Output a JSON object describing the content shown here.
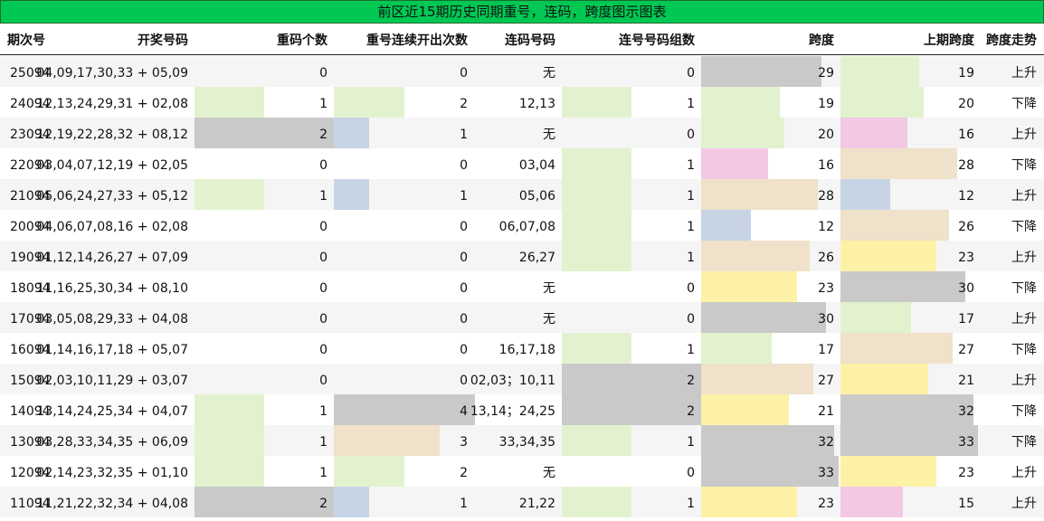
{
  "title": "前区近15期历史同期重号，连码，跨度图示图表",
  "headers": {
    "period": "期次号",
    "numbers": "开奖号码",
    "repeat_count": "重码个数",
    "repeat_streak": "重号连续开出次数",
    "consec_numbers": "连码号码",
    "consec_groups": "连号号码组数",
    "span": "跨度",
    "prev_span": "上期跨度",
    "span_trend": "跨度走势"
  },
  "colors": {
    "title_bg": "#00c853",
    "green": "#e2f2cf",
    "gray": "#c9c9c9",
    "blue": "#c7d4e6",
    "pink": "#f2c8e4",
    "tan": "#efe1ca",
    "yellow": "#fdf1a6"
  },
  "rows": [
    {
      "period": "25094",
      "numbers": "04,09,17,30,33 + 05,09",
      "repeat_count": "0",
      "repeat_streak": "0",
      "consec": "无",
      "groups": "0",
      "span": "29",
      "prev_span": "19",
      "trend": "上升"
    },
    {
      "period": "24094",
      "numbers": "12,13,24,29,31 + 02,08",
      "repeat_count": "1",
      "repeat_streak": "2",
      "consec": "12,13",
      "groups": "1",
      "span": "19",
      "prev_span": "20",
      "trend": "下降"
    },
    {
      "period": "23094",
      "numbers": "12,19,22,28,32 + 08,12",
      "repeat_count": "2",
      "repeat_streak": "1",
      "consec": "无",
      "groups": "0",
      "span": "20",
      "prev_span": "16",
      "trend": "上升"
    },
    {
      "period": "22094",
      "numbers": "03,04,07,12,19 + 02,05",
      "repeat_count": "0",
      "repeat_streak": "0",
      "consec": "03,04",
      "groups": "1",
      "span": "16",
      "prev_span": "28",
      "trend": "下降"
    },
    {
      "period": "21094",
      "numbers": "05,06,24,27,33 + 05,12",
      "repeat_count": "1",
      "repeat_streak": "1",
      "consec": "05,06",
      "groups": "1",
      "span": "28",
      "prev_span": "12",
      "trend": "上升"
    },
    {
      "period": "20094",
      "numbers": "04,06,07,08,16 + 02,08",
      "repeat_count": "0",
      "repeat_streak": "0",
      "consec": "06,07,08",
      "groups": "1",
      "span": "12",
      "prev_span": "26",
      "trend": "下降"
    },
    {
      "period": "19094",
      "numbers": "01,12,14,26,27 + 07,09",
      "repeat_count": "0",
      "repeat_streak": "0",
      "consec": "26,27",
      "groups": "1",
      "span": "26",
      "prev_span": "23",
      "trend": "上升"
    },
    {
      "period": "18094",
      "numbers": "11,16,25,30,34 + 08,10",
      "repeat_count": "0",
      "repeat_streak": "0",
      "consec": "无",
      "groups": "0",
      "span": "23",
      "prev_span": "30",
      "trend": "下降"
    },
    {
      "period": "17094",
      "numbers": "03,05,08,29,33 + 04,08",
      "repeat_count": "0",
      "repeat_streak": "0",
      "consec": "无",
      "groups": "0",
      "span": "30",
      "prev_span": "17",
      "trend": "上升"
    },
    {
      "period": "16094",
      "numbers": "01,14,16,17,18 + 05,07",
      "repeat_count": "0",
      "repeat_streak": "0",
      "consec": "16,17,18",
      "groups": "1",
      "span": "17",
      "prev_span": "27",
      "trend": "下降"
    },
    {
      "period": "15094",
      "numbers": "02,03,10,11,29 + 03,07",
      "repeat_count": "0",
      "repeat_streak": "0",
      "consec": "02,03；10,11",
      "groups": "2",
      "span": "27",
      "prev_span": "21",
      "trend": "上升"
    },
    {
      "period": "14094",
      "numbers": "13,14,24,25,34 + 04,07",
      "repeat_count": "1",
      "repeat_streak": "4",
      "consec": "13,14；24,25",
      "groups": "2",
      "span": "21",
      "prev_span": "32",
      "trend": "下降"
    },
    {
      "period": "13094",
      "numbers": "03,28,33,34,35 + 06,09",
      "repeat_count": "1",
      "repeat_streak": "3",
      "consec": "33,34,35",
      "groups": "1",
      "span": "32",
      "prev_span": "33",
      "trend": "下降"
    },
    {
      "period": "12094",
      "numbers": "02,14,23,32,35 + 01,10",
      "repeat_count": "1",
      "repeat_streak": "2",
      "consec": "无",
      "groups": "0",
      "span": "33",
      "prev_span": "23",
      "trend": "上升"
    },
    {
      "period": "11094",
      "numbers": "11,21,22,32,34 + 04,08",
      "repeat_count": "2",
      "repeat_streak": "1",
      "consec": "21,22",
      "groups": "1",
      "span": "23",
      "prev_span": "15",
      "trend": "上升"
    }
  ]
}
